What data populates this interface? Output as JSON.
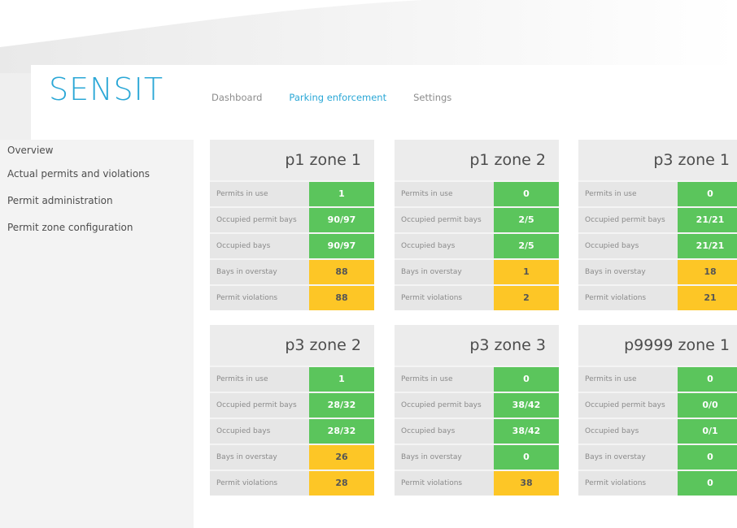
{
  "app": {
    "logo": "SENSIT"
  },
  "nav": {
    "items": [
      {
        "label": "Dashboard",
        "active": false
      },
      {
        "label": "Parking enforcement",
        "active": true
      },
      {
        "label": "Settings",
        "active": false
      }
    ]
  },
  "sidebar": {
    "items": [
      {
        "label": "Overview"
      },
      {
        "label": "Actual permits and violations"
      },
      {
        "label": "Permit administration"
      },
      {
        "label": "Permit zone configuration"
      }
    ]
  },
  "colors": {
    "accent": "#2aa7d6",
    "ok": "#5bc55c",
    "warn": "#fdc626"
  },
  "zones": [
    {
      "title": "p1 zone 1",
      "rows": [
        {
          "label": "Permits in use",
          "value": "1",
          "status": "green"
        },
        {
          "label": "Occupied permit bays",
          "value": "90/97",
          "status": "green"
        },
        {
          "label": "Occupied bays",
          "value": "90/97",
          "status": "green"
        },
        {
          "label": "Bays in overstay",
          "value": "88",
          "status": "yellow"
        },
        {
          "label": "Permit violations",
          "value": "88",
          "status": "yellow"
        }
      ]
    },
    {
      "title": "p1 zone 2",
      "rows": [
        {
          "label": "Permits in use",
          "value": "0",
          "status": "green"
        },
        {
          "label": "Occupied permit bays",
          "value": "2/5",
          "status": "green"
        },
        {
          "label": "Occupied bays",
          "value": "2/5",
          "status": "green"
        },
        {
          "label": "Bays in overstay",
          "value": "1",
          "status": "yellow"
        },
        {
          "label": "Permit violations",
          "value": "2",
          "status": "yellow"
        }
      ]
    },
    {
      "title": "p3 zone 1",
      "rows": [
        {
          "label": "Permits in use",
          "value": "0",
          "status": "green"
        },
        {
          "label": "Occupied permit bays",
          "value": "21/21",
          "status": "green"
        },
        {
          "label": "Occupied bays",
          "value": "21/21",
          "status": "green"
        },
        {
          "label": "Bays in overstay",
          "value": "18",
          "status": "yellow"
        },
        {
          "label": "Permit violations",
          "value": "21",
          "status": "yellow"
        }
      ]
    },
    {
      "title": "p3 zone 2",
      "rows": [
        {
          "label": "Permits in use",
          "value": "1",
          "status": "green"
        },
        {
          "label": "Occupied permit bays",
          "value": "28/32",
          "status": "green"
        },
        {
          "label": "Occupied bays",
          "value": "28/32",
          "status": "green"
        },
        {
          "label": "Bays in overstay",
          "value": "26",
          "status": "yellow"
        },
        {
          "label": "Permit violations",
          "value": "28",
          "status": "yellow"
        }
      ]
    },
    {
      "title": "p3 zone 3",
      "rows": [
        {
          "label": "Permits in use",
          "value": "0",
          "status": "green"
        },
        {
          "label": "Occupied permit bays",
          "value": "38/42",
          "status": "green"
        },
        {
          "label": "Occupied bays",
          "value": "38/42",
          "status": "green"
        },
        {
          "label": "Bays in overstay",
          "value": "0",
          "status": "green"
        },
        {
          "label": "Permit violations",
          "value": "38",
          "status": "yellow"
        }
      ]
    },
    {
      "title": "p9999 zone 1",
      "rows": [
        {
          "label": "Permits in use",
          "value": "0",
          "status": "green"
        },
        {
          "label": "Occupied permit bays",
          "value": "0/0",
          "status": "green"
        },
        {
          "label": "Occupied bays",
          "value": "0/1",
          "status": "green"
        },
        {
          "label": "Bays in overstay",
          "value": "0",
          "status": "green"
        },
        {
          "label": "Permit violations",
          "value": "0",
          "status": "green"
        }
      ]
    }
  ]
}
